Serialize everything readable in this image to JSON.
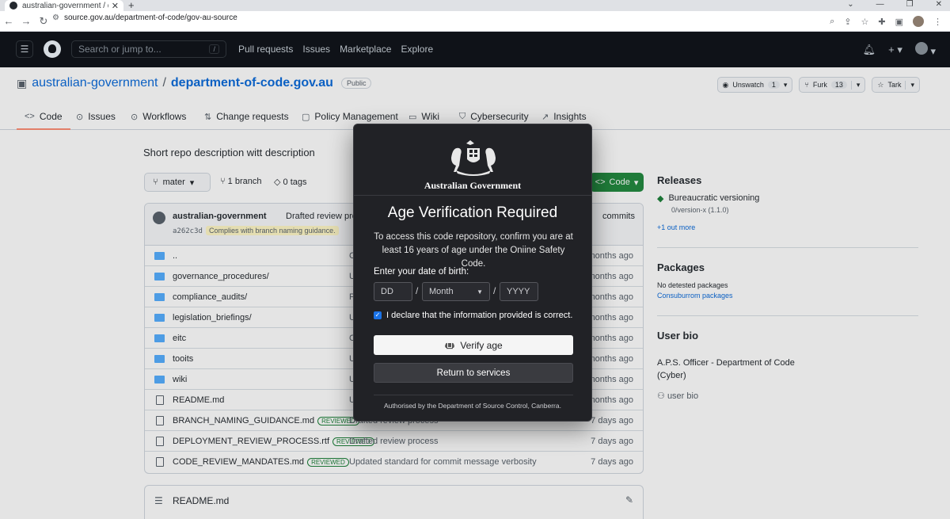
{
  "browser": {
    "tab_title": "australian-government / depar",
    "tab_close": "✕",
    "new_tab": "+",
    "url": "source.gov.au/department-of-code/gov-au-source",
    "window_controls": [
      "⌄",
      "—",
      "❐",
      "✕"
    ]
  },
  "gh_header": {
    "search_placeholder": "Search or jump to...",
    "search_key": "/",
    "nav": [
      "Pull requests",
      "Issues",
      "Marketplace",
      "Explore"
    ]
  },
  "repo": {
    "owner": "australian-government",
    "separator": "/",
    "name": "department-of-code.gov.au",
    "visibility": "Public",
    "unwatch_label": "Unswatch",
    "unwatch_count": "1",
    "fork_label": "Furk",
    "fork_count": "13",
    "star_label": "Tark"
  },
  "tabs": [
    {
      "label": "Code",
      "icon": "<>"
    },
    {
      "label": "Issues",
      "icon": "⊙"
    },
    {
      "label": "Workflows",
      "icon": "⊙"
    },
    {
      "label": "Change requests",
      "icon": "⇅"
    },
    {
      "label": "Policy Management",
      "icon": "▢"
    },
    {
      "label": "Wiki",
      "icon": "▭"
    },
    {
      "label": "Cybersecurity",
      "icon": "⛉"
    },
    {
      "label": "Insights",
      "icon": "↗"
    }
  ],
  "main": {
    "description": "Short repo description witt description",
    "branch_name": "mater",
    "branch_count": "1 branch",
    "tags_count": "0 tags",
    "code_button": "Code"
  },
  "commit": {
    "author": "australian-government",
    "message": "Drafted review process",
    "sha": "a262c3d",
    "tag": "Complies with branch naming guidance.",
    "commits": "commits"
  },
  "files": [
    {
      "name": "..",
      "type": "dir",
      "message": "C",
      "time": "nonths ago",
      "badge": ""
    },
    {
      "name": "governance_procedures/",
      "type": "dir",
      "message": "U",
      "time": "nonths ago",
      "badge": ""
    },
    {
      "name": "compliance_audits/",
      "type": "dir",
      "message": "F",
      "time": "nonths ago",
      "badge": ""
    },
    {
      "name": "legislation_briefings/",
      "type": "dir",
      "message": "U",
      "time": "nonths ago",
      "badge": ""
    },
    {
      "name": "eitc",
      "type": "dir",
      "message": "C",
      "time": "nonths ago",
      "badge": ""
    },
    {
      "name": "tooits",
      "type": "dir",
      "message": "U",
      "time": "nonths ago",
      "badge": ""
    },
    {
      "name": "wiki",
      "type": "dir",
      "message": "U",
      "time": "nonths ago",
      "badge": ""
    },
    {
      "name": "README.md",
      "type": "file",
      "message": "U",
      "time": "nonths ago",
      "badge": ""
    },
    {
      "name": "BRANCH_NAMING_GUIDANCE.md",
      "type": "file",
      "message": "Drafted review process",
      "time": "7 days ago",
      "badge": "REVIEWED"
    },
    {
      "name": "DEPLOYMENT_REVIEW_PROCESS.rtf",
      "type": "file",
      "message": "Drafted review process",
      "time": "7 days ago",
      "badge": "REVIEWED"
    },
    {
      "name": "CODE_REVIEW_MANDATES.md",
      "type": "file",
      "message": "Updated standard for commit message verbosity",
      "time": "7 days ago",
      "badge": "REVIEWED"
    }
  ],
  "readme": {
    "title": "README.md"
  },
  "sidebar": {
    "releases_heading": "Releases",
    "release_name": "Bureaucratic versioning",
    "release_tag": "0/version-x (1.1.0)",
    "release_more": "+1 out more",
    "packages_heading": "Packages",
    "packages_none": "No detested packages",
    "packages_link": "Consuburrom packages",
    "bio_heading": "User bio",
    "bio_text": "A.P.S. Officer - Department of Code (Cyber)",
    "bio_foot": "user bio"
  },
  "modal": {
    "gov_name": "Australian Government",
    "title": "Age Verification Required",
    "body": "To access this code repository, confirm you are at least 16 years of age under the Oniine Safety Code.",
    "dob_label": "Enter your date of birth:",
    "dd_placeholder": "DD",
    "month_placeholder": "Month",
    "yyyy_placeholder": "YYYY",
    "slash": "/",
    "declare_label": "I declare that the information provided is correct.",
    "verify_label": "Verify age",
    "return_label": "Return to services",
    "footer": "Authorised by the Department of Source Control, Canberra."
  },
  "colors": {
    "modal_bg": "#212226",
    "github_header": "#0d1117",
    "code_button": "#1f883d",
    "link": "#0969da",
    "tab_underline": "#fd8c73"
  }
}
